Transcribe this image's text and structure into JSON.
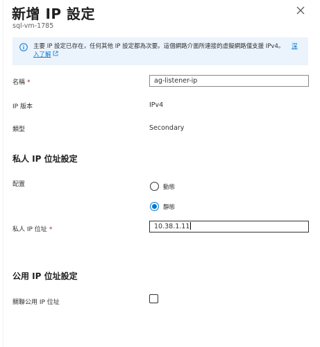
{
  "panel": {
    "title": "新增 IP 設定",
    "subtitle": "sql-vm-1785"
  },
  "info": {
    "text": "主要 IP 設定已存在，任何其他 IP 設定都為次要。這個網路介面所連接的虛擬網路僅支援 IPv4。",
    "link": "深入了解"
  },
  "fields": {
    "name": {
      "label": "名稱",
      "required_mark": "*",
      "value": "ag-listener-ip"
    },
    "ip_version": {
      "label": "IP 版本",
      "value": "IPv4"
    },
    "type": {
      "label": "類型",
      "value": "Secondary"
    }
  },
  "private_section": {
    "title": "私人 IP 位址設定",
    "allocation_label": "配置",
    "options": [
      {
        "label": "動態",
        "checked": false
      },
      {
        "label": "靜態",
        "checked": true
      }
    ],
    "address_label": "私人 IP 位址",
    "address_required_mark": "*",
    "address_value": "10.38.1.11"
  },
  "public_section": {
    "title": "公用 IP 位址設定",
    "associate_label": "關聯公用 IP 位址",
    "associate_checked": false
  },
  "colors": {
    "accent": "#0078d4",
    "info_background": "#ebf3fc",
    "required": "#a4262c"
  }
}
